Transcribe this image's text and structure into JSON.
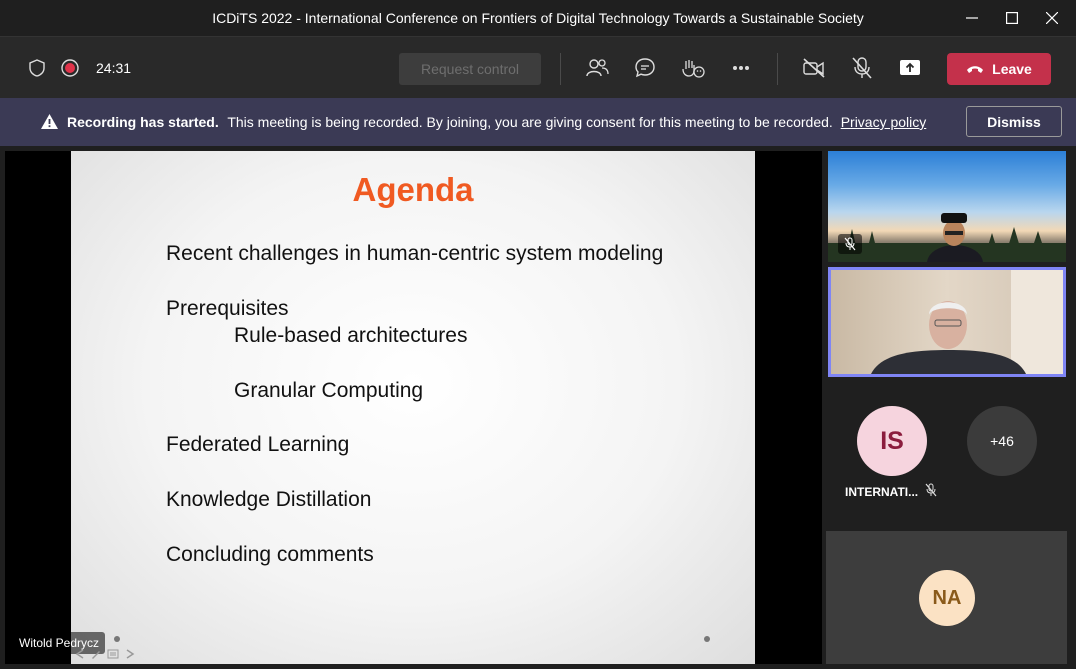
{
  "window": {
    "title": "ICDiTS 2022 - International Conference on Frontiers of Digital Technology Towards a Sustainable Society"
  },
  "toolbar": {
    "timer": "24:31",
    "request_control_label": "Request control",
    "leave_label": "Leave"
  },
  "banner": {
    "title": "Recording has started.",
    "message": "This meeting is being recorded. By joining, you are giving consent for this meeting to be recorded.",
    "link": "Privacy policy",
    "dismiss_label": "Dismiss"
  },
  "slide": {
    "title": "Agenda",
    "items": [
      "Recent challenges in human-centric system modeling",
      "Prerequisites",
      "Rule-based architectures",
      "Granular Computing",
      "Federated Learning",
      "Knowledge Distillation",
      "Concluding comments"
    ]
  },
  "presenter_name": "Witold Pedrycz",
  "gallery": {
    "participant_initials": "IS",
    "participant_name": "INTERNATI...",
    "more_count": "+46",
    "participant2_initials": "NA"
  },
  "colors": {
    "leave": "#c4314b",
    "banner": "#3b3a55",
    "slide_title": "#f05a22",
    "active_speaker_border": "#7f85f5"
  }
}
